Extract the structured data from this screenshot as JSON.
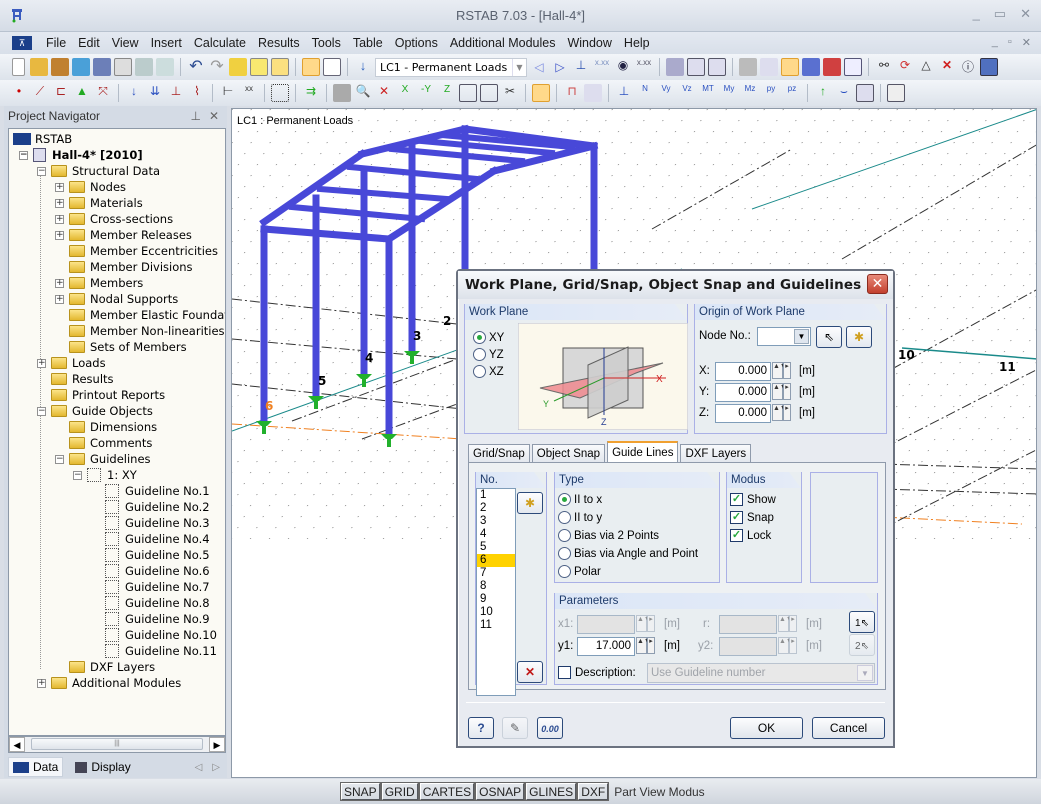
{
  "window": {
    "title": "RSTAB 7.03 - [Hall-4*]",
    "controls": [
      "minimize",
      "maximize",
      "close"
    ]
  },
  "menu": {
    "items": [
      "File",
      "Edit",
      "View",
      "Insert",
      "Calculate",
      "Results",
      "Tools",
      "Table",
      "Options",
      "Additional Modules",
      "Window",
      "Help"
    ]
  },
  "toolbar": {
    "load_case": "LC1 - Permanent Loads"
  },
  "navigator": {
    "title": "Project Navigator",
    "root": "RSTAB",
    "project": "Hall-4* [2010]",
    "items": [
      {
        "label": "Structural Data",
        "level": 1,
        "expander": "minus"
      },
      {
        "label": "Nodes",
        "level": 2,
        "expander": "plus"
      },
      {
        "label": "Materials",
        "level": 2,
        "expander": "plus"
      },
      {
        "label": "Cross-sections",
        "level": 2,
        "expander": "plus"
      },
      {
        "label": "Member Releases",
        "level": 2,
        "expander": "plus"
      },
      {
        "label": "Member Eccentricities",
        "level": 2,
        "expander": "none"
      },
      {
        "label": "Member Divisions",
        "level": 2,
        "expander": "none"
      },
      {
        "label": "Members",
        "level": 2,
        "expander": "plus"
      },
      {
        "label": "Nodal Supports",
        "level": 2,
        "expander": "plus"
      },
      {
        "label": "Member Elastic Foundations",
        "level": 2,
        "expander": "none"
      },
      {
        "label": "Member Non-linearities",
        "level": 2,
        "expander": "none"
      },
      {
        "label": "Sets of Members",
        "level": 2,
        "expander": "none"
      },
      {
        "label": "Loads",
        "level": 1,
        "expander": "plus"
      },
      {
        "label": "Results",
        "level": 1,
        "expander": "none"
      },
      {
        "label": "Printout Reports",
        "level": 1,
        "expander": "none"
      },
      {
        "label": "Guide Objects",
        "level": 1,
        "expander": "minus"
      },
      {
        "label": "Dimensions",
        "level": 2,
        "expander": "none"
      },
      {
        "label": "Comments",
        "level": 2,
        "expander": "none"
      },
      {
        "label": "Guidelines",
        "level": 2,
        "expander": "minus"
      },
      {
        "label": "1: XY",
        "level": 3,
        "expander": "minus"
      },
      {
        "label": "Guideline No.1",
        "level": 4,
        "expander": "none"
      },
      {
        "label": "Guideline No.2",
        "level": 4,
        "expander": "none"
      },
      {
        "label": "Guideline No.3",
        "level": 4,
        "expander": "none"
      },
      {
        "label": "Guideline No.4",
        "level": 4,
        "expander": "none"
      },
      {
        "label": "Guideline No.5",
        "level": 4,
        "expander": "none"
      },
      {
        "label": "Guideline No.6",
        "level": 4,
        "expander": "none"
      },
      {
        "label": "Guideline No.7",
        "level": 4,
        "expander": "none"
      },
      {
        "label": "Guideline No.8",
        "level": 4,
        "expander": "none"
      },
      {
        "label": "Guideline No.9",
        "level": 4,
        "expander": "none"
      },
      {
        "label": "Guideline No.10",
        "level": 4,
        "expander": "none"
      },
      {
        "label": "Guideline No.11",
        "level": 4,
        "expander": "none"
      },
      {
        "label": "DXF Layers",
        "level": 2,
        "expander": "none"
      },
      {
        "label": "Additional Modules",
        "level": 1,
        "expander": "plus"
      }
    ],
    "tabs": [
      "Data",
      "Display"
    ]
  },
  "viewport": {
    "load_case_label": "LC1 : Permanent Loads",
    "node_labels": [
      "2",
      "3",
      "4",
      "5",
      "6",
      "10",
      "11"
    ],
    "member_color": "#4848d8",
    "support_color": "#22b02c",
    "highlight_color": "#f08020"
  },
  "dialog": {
    "title": "Work Plane, Grid/Snap, Object Snap and Guidelines",
    "work_plane": {
      "header": "Work Plane",
      "options": [
        "XY",
        "YZ",
        "XZ"
      ],
      "selected": "XY"
    },
    "origin": {
      "header": "Origin of Work Plane",
      "node_label": "Node No.:",
      "node_value": "",
      "x_label": "X:",
      "x_value": "0.000",
      "y_label": "Y:",
      "y_value": "0.000",
      "z_label": "Z:",
      "z_value": "0.000",
      "unit": "[m]"
    },
    "tabs": [
      "Grid/Snap",
      "Object Snap",
      "Guide Lines",
      "DXF Layers"
    ],
    "active_tab": "Guide Lines",
    "guide_lines": {
      "no_header": "No.",
      "numbers": [
        "1",
        "2",
        "3",
        "4",
        "5",
        "6",
        "7",
        "8",
        "9",
        "10",
        "11"
      ],
      "selected_number": "6",
      "type_header": "Type",
      "types": [
        "II to x",
        "II to y",
        "Bias via 2 Points",
        "Bias via Angle and Point",
        "Polar"
      ],
      "selected_type": "II to x",
      "modus_header": "Modus",
      "modus": [
        {
          "label": "Show",
          "checked": true
        },
        {
          "label": "Snap",
          "checked": true
        },
        {
          "label": "Lock",
          "checked": true
        }
      ],
      "parameters_header": "Parameters",
      "x1_label": "x1:",
      "x1_value": "",
      "y1_label": "y1:",
      "y1_value": "17.000",
      "r_label": "r:",
      "r_value": "",
      "y2_label": "y2:",
      "y2_value": "",
      "unit": "[m]",
      "description_label": "Description:",
      "description_checked": false,
      "description_value": "Use Guideline number"
    },
    "buttons": {
      "ok": "OK",
      "cancel": "Cancel"
    }
  },
  "statusbar": {
    "toggles": [
      "SNAP",
      "GRID",
      "CARTES",
      "OSNAP",
      "GLINES",
      "DXF"
    ],
    "mode_text": "Part View Modus"
  }
}
